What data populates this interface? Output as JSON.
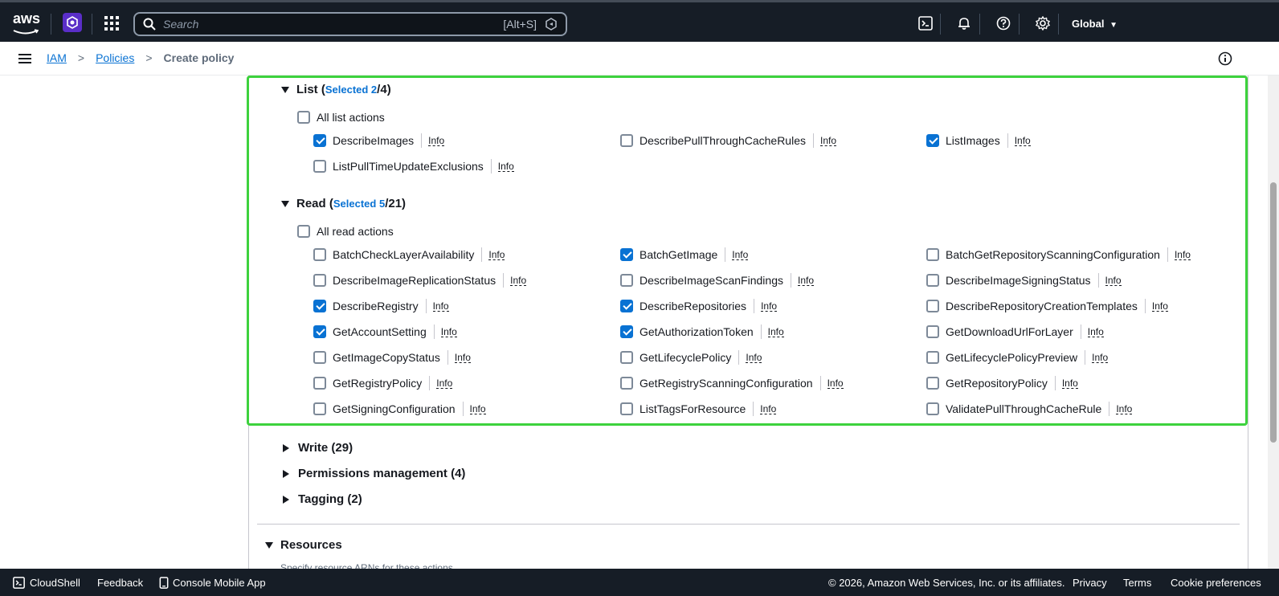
{
  "topnav": {
    "logo_text": "aws",
    "search_placeholder": "Search",
    "search_shortcut": "[Alt+S]",
    "region": "Global"
  },
  "breadcrumb": {
    "items": [
      "IAM",
      "Policies"
    ],
    "current": "Create policy"
  },
  "list_section": {
    "title": "List",
    "selected_label": "Selected 2",
    "total": "/4",
    "all_label": "All list actions",
    "actions": [
      {
        "name": "DescribeImages",
        "checked": true
      },
      {
        "name": "DescribePullThroughCacheRules",
        "checked": false
      },
      {
        "name": "ListImages",
        "checked": true
      },
      {
        "name": "ListPullTimeUpdateExclusions",
        "checked": false
      }
    ]
  },
  "read_section": {
    "title": "Read",
    "selected_label": "Selected 5",
    "total": "/21",
    "all_label": "All read actions",
    "actions": [
      {
        "name": "BatchCheckLayerAvailability",
        "checked": false
      },
      {
        "name": "BatchGetImage",
        "checked": true
      },
      {
        "name": "BatchGetRepositoryScanningConfiguration",
        "checked": false
      },
      {
        "name": "DescribeImageReplicationStatus",
        "checked": false
      },
      {
        "name": "DescribeImageScanFindings",
        "checked": false
      },
      {
        "name": "DescribeImageSigningStatus",
        "checked": false
      },
      {
        "name": "DescribeRegistry",
        "checked": true
      },
      {
        "name": "DescribeRepositories",
        "checked": true
      },
      {
        "name": "DescribeRepositoryCreationTemplates",
        "checked": false
      },
      {
        "name": "GetAccountSetting",
        "checked": true
      },
      {
        "name": "GetAuthorizationToken",
        "checked": true
      },
      {
        "name": "GetDownloadUrlForLayer",
        "checked": false
      },
      {
        "name": "GetImageCopyStatus",
        "checked": false
      },
      {
        "name": "GetLifecyclePolicy",
        "checked": false
      },
      {
        "name": "GetLifecyclePolicyPreview",
        "checked": false
      },
      {
        "name": "GetRegistryPolicy",
        "checked": false
      },
      {
        "name": "GetRegistryScanningConfiguration",
        "checked": false
      },
      {
        "name": "GetRepositoryPolicy",
        "checked": false
      },
      {
        "name": "GetSigningConfiguration",
        "checked": false
      },
      {
        "name": "ListTagsForResource",
        "checked": false
      },
      {
        "name": "ValidatePullThroughCacheRule",
        "checked": false
      }
    ]
  },
  "info_label": "Info",
  "collapsed_sections": [
    {
      "label": "Write (29)"
    },
    {
      "label": "Permissions management (4)"
    },
    {
      "label": "Tagging (2)"
    }
  ],
  "resources": {
    "title": "Resources",
    "subtitle": "Specify resource ARNs for these actions."
  },
  "footer": {
    "cloudshell": "CloudShell",
    "feedback": "Feedback",
    "mobile_app": "Console Mobile App",
    "copyright": "© 2026, Amazon Web Services, Inc. or its affiliates.",
    "privacy": "Privacy",
    "terms": "Terms",
    "cookies": "Cookie preferences"
  }
}
